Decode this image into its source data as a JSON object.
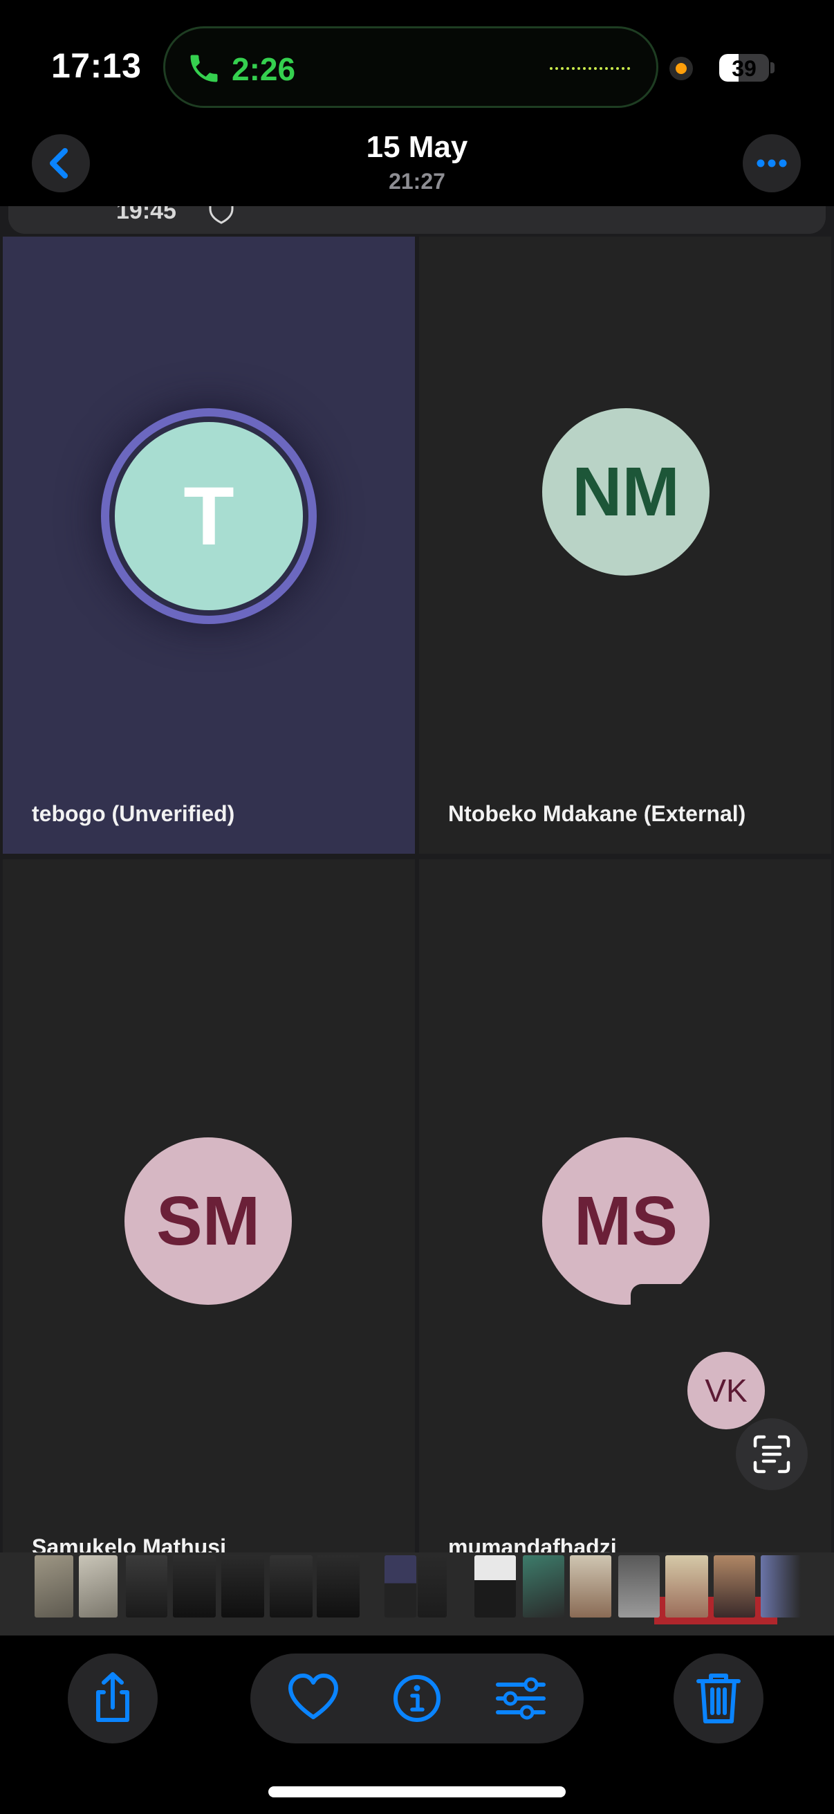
{
  "status_bar": {
    "time": "17:13",
    "call_timer": "2:26",
    "battery_level": "39",
    "battery_fraction": 0.39,
    "call_color": "#35d04f"
  },
  "nav": {
    "title": "15 May",
    "subtitle": "21:27",
    "back_icon": "chevron-left-icon",
    "more_icon": "ellipsis-icon",
    "accent": "#0a84ff"
  },
  "screenshot": {
    "banner_time": "19:45",
    "participants": [
      {
        "initials": "T",
        "name": "tebogo (Unverified)",
        "speaking": true
      },
      {
        "initials": "NM",
        "name": "Ntobeko Mdakane (External)",
        "speaking": false
      },
      {
        "initials": "SM",
        "name": "Samukelo Mathusi",
        "speaking": false
      },
      {
        "initials": "MS",
        "name": "mumandafhadzi",
        "speaking": false
      }
    ],
    "self_view_initials": "VK",
    "scan_icon": "live-text-icon"
  },
  "toolbar": {
    "share_icon": "share-icon",
    "favorite_icon": "heart-icon",
    "info_icon": "info-icon",
    "adjust_icon": "sliders-icon",
    "delete_icon": "trash-icon"
  }
}
